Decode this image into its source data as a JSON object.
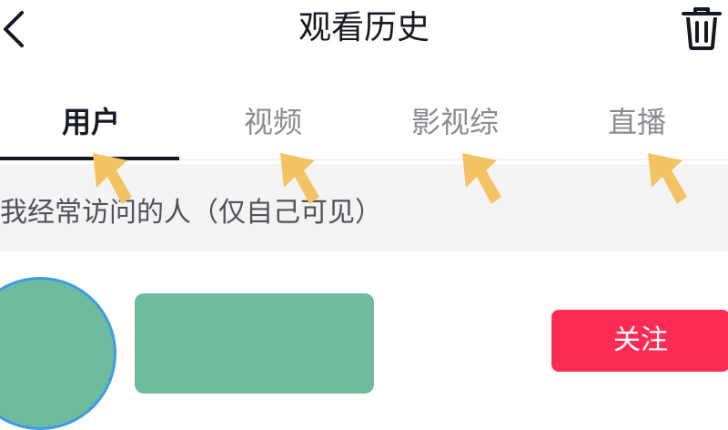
{
  "header": {
    "title": "观看历史",
    "back_icon": "chevron-left-icon",
    "delete_icon": "trash-icon"
  },
  "tabs": [
    {
      "label": "用户",
      "active": true
    },
    {
      "label": "视频",
      "active": false
    },
    {
      "label": "影视综",
      "active": false
    },
    {
      "label": "直播",
      "active": false
    }
  ],
  "section": {
    "label": "我经常访问的人（仅自己可见）"
  },
  "user_row": {
    "follow_label": "关注"
  },
  "annotations": {
    "arrow_icon": "pointer-arrow-icon",
    "arrow_color": "#f3c463"
  },
  "colors": {
    "accent": "#fe2c55",
    "avatar_placeholder": "#6ebc9d",
    "avatar_ring": "#3d9be9",
    "text_primary": "#161823",
    "text_secondary": "#8a8b91",
    "section_bg": "#f4f4f5"
  }
}
